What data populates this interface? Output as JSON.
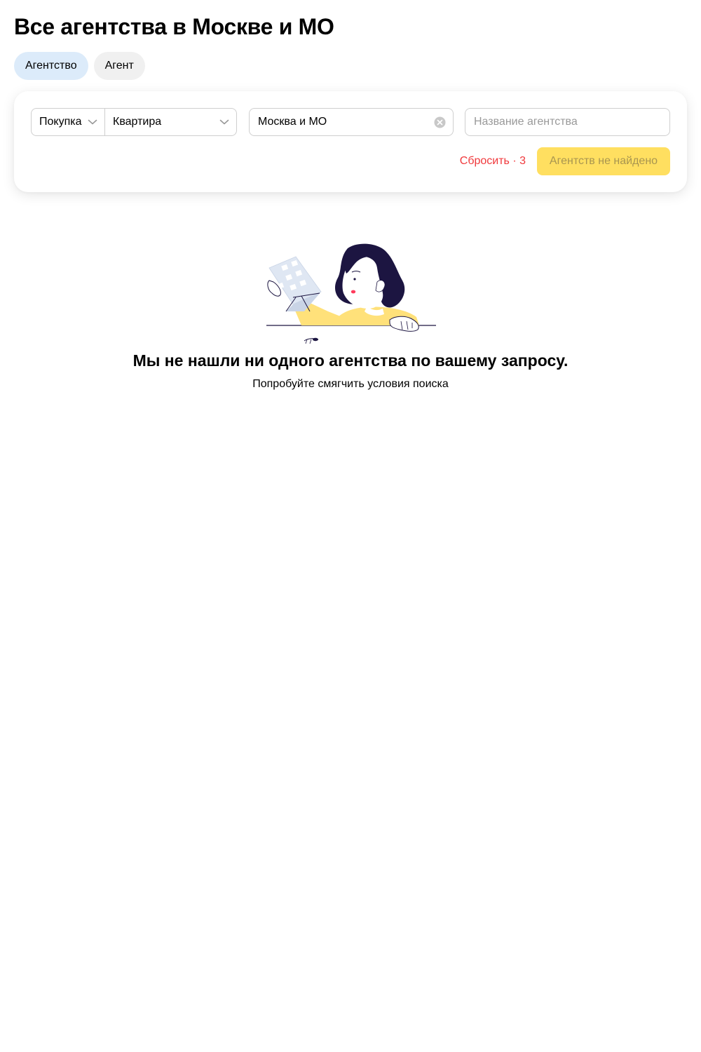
{
  "page": {
    "title": "Все агентства в Москве и МО"
  },
  "tabs": [
    {
      "label": "Агентство",
      "active": true
    },
    {
      "label": "Агент",
      "active": false
    }
  ],
  "filters": {
    "deal_type": {
      "value": "Покупка"
    },
    "property_type": {
      "value": "Квартира"
    },
    "region": {
      "value": "Москва и МО"
    },
    "agency_name": {
      "value": "",
      "placeholder": "Название агентства"
    },
    "reset_label": "Сбросить · 3",
    "submit_label": "Агентств не найдено"
  },
  "empty_state": {
    "title": "Мы не нашли ни одного агентства по вашему запросу.",
    "subtitle": "Попробуйте смягчить условия поиска"
  },
  "colors": {
    "active_tab": "#dcebfa",
    "inactive_tab": "#f0f0f0",
    "reset": "#f0393c",
    "button": "#ffdf60",
    "button_text": "#a89550",
    "illustration_hair": "#1c1541",
    "illustration_shirt": "#ffe17a",
    "illustration_building": "#dfe7f3"
  },
  "icons": {
    "deal_chevron": "chevron-down-icon",
    "type_chevron": "chevron-down-icon",
    "region_clear": "clear-icon"
  }
}
